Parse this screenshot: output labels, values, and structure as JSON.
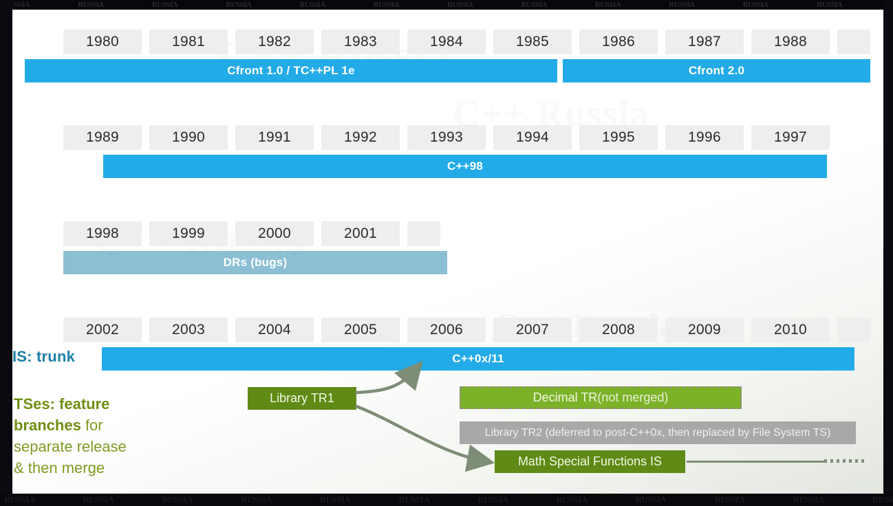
{
  "slide": {
    "title_hidden": "C++ standardization timeline",
    "edge_watermarks": [
      "RUSSIA",
      "RUSSIA",
      "RUSSIA",
      "RUSSIA",
      "RUSSIA",
      "RUSSIA",
      "RUSSIA",
      "RUSSIA",
      "RUSSIA",
      "RUSSIA",
      "RUSSIA",
      "RUSSIA",
      "RUSSIA",
      "RUSSIA",
      "RUSSIA",
      "RUSSIA"
    ],
    "rail_watermark": "RUSSIA",
    "ghost_watermark": "C++ Russia"
  },
  "colors": {
    "blue": "#23abe8",
    "dull_blue": "#8cbfd3",
    "year_cell": "#eeeeee",
    "trunk_label": "#1e7fa8",
    "olive_green": "#5f8a15",
    "bright_green": "#7cb228",
    "gray_box": "#a8a8a8",
    "note_green": "#7e9c22",
    "arrow": "#7d8d76",
    "slide_bg": "#ffffff"
  },
  "rows": [
    {
      "id": "row-1980s",
      "years": [
        "1980",
        "1981",
        "1982",
        "1983",
        "1984",
        "1985",
        "1986",
        "1987",
        "1988",
        ""
      ],
      "bars": [
        {
          "id": "cfront-1",
          "label": "Cfront 1.0 / TC++PL 1e",
          "style": "blue"
        },
        {
          "id": "cfront-2",
          "label": "Cfront 2.0",
          "style": "blue"
        }
      ]
    },
    {
      "id": "row-1990s",
      "years": [
        "1989",
        "1990",
        "1991",
        "1992",
        "1993",
        "1994",
        "1995",
        "1996",
        "1997"
      ],
      "bars": [
        {
          "id": "cpp98",
          "label": "C++98",
          "style": "blue"
        }
      ]
    },
    {
      "id": "row-1998",
      "years": [
        "1998",
        "1999",
        "2000",
        "2001",
        ""
      ],
      "bars": [
        {
          "id": "drs",
          "label": "DRs (bugs)",
          "style": "dull"
        }
      ]
    },
    {
      "id": "row-2000s",
      "years": [
        "2002",
        "2003",
        "2004",
        "2005",
        "2006",
        "2007",
        "2008",
        "2009",
        "2010",
        ""
      ],
      "bars": [
        {
          "id": "cpp0x11",
          "label": "C++0x/11",
          "style": "blue"
        }
      ]
    }
  ],
  "legend": {
    "trunk_label": "IS: trunk",
    "ts_note_bold_1": "TSes: feature",
    "ts_note_bold_2": "branches",
    "ts_note_rest_2": " for",
    "ts_note_line_3": "separate release",
    "ts_note_line_4": "& then merge"
  },
  "ts_boxes": [
    {
      "id": "library-tr1",
      "label": "Library TR1",
      "style": "olive"
    },
    {
      "id": "decimal-tr",
      "label": "Decimal TR ",
      "suffix": "(not merged)",
      "style": "bright-dashed"
    },
    {
      "id": "library-tr2",
      "label": "Library TR2 (deferred to post-C++0x, then replaced by File System TS)",
      "style": "gray"
    },
    {
      "id": "math-special-functions-is",
      "label": "Math Special Functions IS",
      "style": "olive"
    }
  ]
}
